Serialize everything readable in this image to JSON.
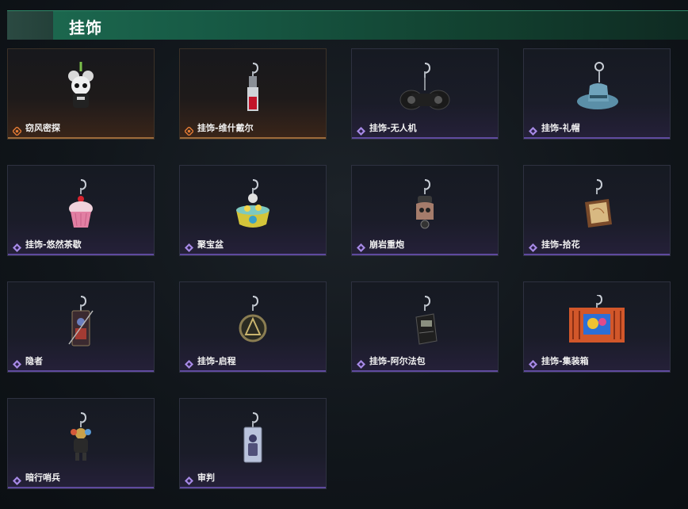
{
  "section": {
    "title": "挂饰"
  },
  "items": [
    {
      "label": "窃风密探",
      "rarity": "gold",
      "icon": "spy-mouse-charm-icon"
    },
    {
      "label": "挂饰-维什戴尔",
      "rarity": "gold",
      "icon": "red-lantern-charm-icon"
    },
    {
      "label": "挂饰-无人机",
      "rarity": "purple",
      "icon": "drone-charm-icon"
    },
    {
      "label": "挂饰-礼帽",
      "rarity": "purple",
      "icon": "top-hat-charm-icon"
    },
    {
      "label": "挂饰-悠然茶歇",
      "rarity": "purple",
      "icon": "cupcake-charm-icon"
    },
    {
      "label": "聚宝盆",
      "rarity": "purple",
      "icon": "treasure-bowl-charm-icon"
    },
    {
      "label": "崩岩重炮",
      "rarity": "purple",
      "icon": "robot-cannon-charm-icon"
    },
    {
      "label": "挂饰-拾花",
      "rarity": "purple",
      "icon": "picture-frame-charm-icon"
    },
    {
      "label": "隐者",
      "rarity": "purple",
      "icon": "tarot-card-charm-icon"
    },
    {
      "label": "挂饰-启程",
      "rarity": "purple",
      "icon": "round-badge-charm-icon"
    },
    {
      "label": "挂饰-阿尔法包",
      "rarity": "purple",
      "icon": "pouch-charm-icon"
    },
    {
      "label": "挂饰-集装箱",
      "rarity": "purple",
      "icon": "container-charm-icon"
    },
    {
      "label": "暗行哨兵",
      "rarity": "purple",
      "icon": "sentinel-figure-charm-icon"
    },
    {
      "label": "审判",
      "rarity": "purple",
      "icon": "card-tag-charm-icon"
    }
  ],
  "colors": {
    "header_green": "#1d6a50",
    "rarity_gold": "#e07a35",
    "rarity_purple": "#a78ae6"
  }
}
